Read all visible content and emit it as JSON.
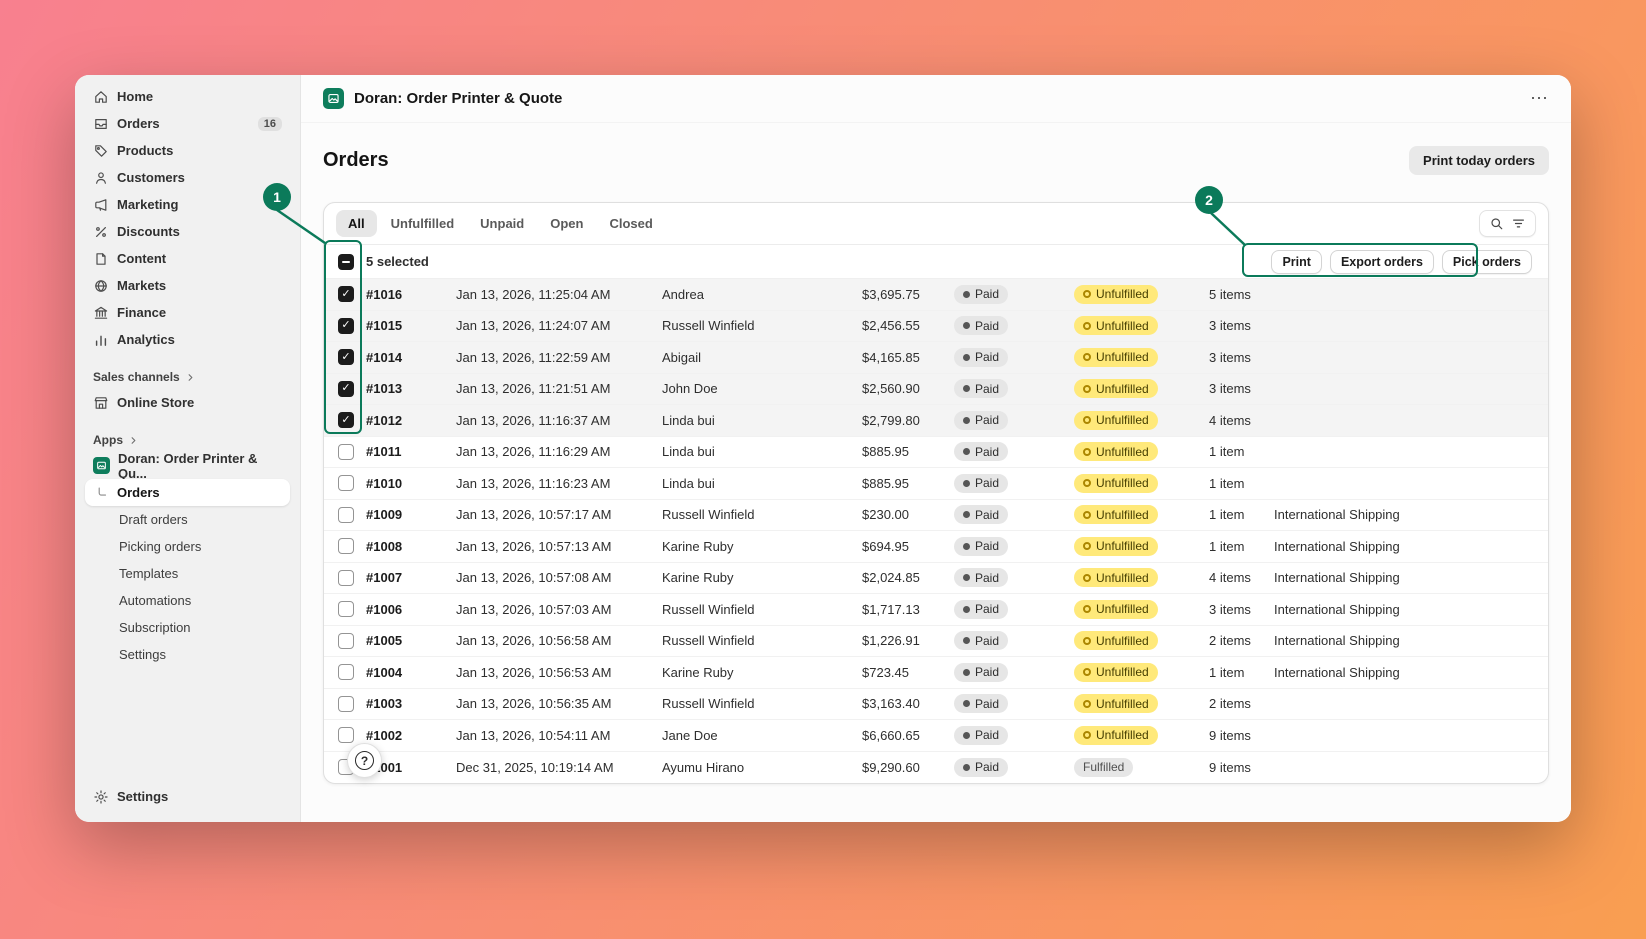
{
  "colors": {
    "annotation_green": "#0b7a5a",
    "badge_yellow": "#ffe97a",
    "badge_gray": "#e6e6e6",
    "gradient_start": "#f8808f",
    "gradient_end": "#f99e51"
  },
  "sidebar": {
    "items": [
      {
        "label": "Home",
        "icon": "home"
      },
      {
        "label": "Orders",
        "icon": "orders",
        "badge": "16"
      },
      {
        "label": "Products",
        "icon": "products"
      },
      {
        "label": "Customers",
        "icon": "customers"
      },
      {
        "label": "Marketing",
        "icon": "marketing"
      },
      {
        "label": "Discounts",
        "icon": "discounts"
      },
      {
        "label": "Content",
        "icon": "content"
      },
      {
        "label": "Markets",
        "icon": "markets"
      },
      {
        "label": "Finance",
        "icon": "finance"
      },
      {
        "label": "Analytics",
        "icon": "analytics"
      }
    ],
    "sales_channels_label": "Sales channels",
    "online_store_label": "Online Store",
    "apps_label": "Apps",
    "app_name": "Doran: Order Printer & Qu...",
    "app_sub_items": [
      "Orders",
      "Draft orders",
      "Picking orders",
      "Templates",
      "Automations",
      "Subscription",
      "Settings"
    ],
    "footer_settings_label": "Settings"
  },
  "header": {
    "app_title": "Doran: Order Printer & Quote",
    "overflow_menu": "⋯"
  },
  "page": {
    "title": "Orders",
    "primary_action": "Print today orders"
  },
  "tabs": {
    "items": [
      "All",
      "Unfulfilled",
      "Unpaid",
      "Open",
      "Closed"
    ],
    "active": "All"
  },
  "selection": {
    "label": "5 selected",
    "actions": [
      "Print",
      "Export orders",
      "Pick orders"
    ]
  },
  "orders": [
    {
      "id": "#1016",
      "date": "Jan 13, 2026, 11:25:04 AM",
      "customer": "Andrea",
      "total": "$3,695.75",
      "payment": "Paid",
      "fulfillment": "Unfulfilled",
      "items": "5 items",
      "delivery": "",
      "checked": true
    },
    {
      "id": "#1015",
      "date": "Jan 13, 2026, 11:24:07 AM",
      "customer": "Russell Winfield",
      "total": "$2,456.55",
      "payment": "Paid",
      "fulfillment": "Unfulfilled",
      "items": "3 items",
      "delivery": "",
      "checked": true
    },
    {
      "id": "#1014",
      "date": "Jan 13, 2026, 11:22:59 AM",
      "customer": "Abigail",
      "total": "$4,165.85",
      "payment": "Paid",
      "fulfillment": "Unfulfilled",
      "items": "3 items",
      "delivery": "",
      "checked": true
    },
    {
      "id": "#1013",
      "date": "Jan 13, 2026, 11:21:51 AM",
      "customer": "John Doe",
      "total": "$2,560.90",
      "payment": "Paid",
      "fulfillment": "Unfulfilled",
      "items": "3 items",
      "delivery": "",
      "checked": true
    },
    {
      "id": "#1012",
      "date": "Jan 13, 2026, 11:16:37 AM",
      "customer": "Linda bui",
      "total": "$2,799.80",
      "payment": "Paid",
      "fulfillment": "Unfulfilled",
      "items": "4 items",
      "delivery": "",
      "checked": true
    },
    {
      "id": "#1011",
      "date": "Jan 13, 2026, 11:16:29 AM",
      "customer": "Linda bui",
      "total": "$885.95",
      "payment": "Paid",
      "fulfillment": "Unfulfilled",
      "items": "1 item",
      "delivery": "",
      "checked": false
    },
    {
      "id": "#1010",
      "date": "Jan 13, 2026, 11:16:23 AM",
      "customer": "Linda bui",
      "total": "$885.95",
      "payment": "Paid",
      "fulfillment": "Unfulfilled",
      "items": "1 item",
      "delivery": "",
      "checked": false
    },
    {
      "id": "#1009",
      "date": "Jan 13, 2026, 10:57:17 AM",
      "customer": "Russell Winfield",
      "total": "$230.00",
      "payment": "Paid",
      "fulfillment": "Unfulfilled",
      "items": "1 item",
      "delivery": "International Shipping",
      "checked": false
    },
    {
      "id": "#1008",
      "date": "Jan 13, 2026, 10:57:13 AM",
      "customer": "Karine Ruby",
      "total": "$694.95",
      "payment": "Paid",
      "fulfillment": "Unfulfilled",
      "items": "1 item",
      "delivery": "International Shipping",
      "checked": false
    },
    {
      "id": "#1007",
      "date": "Jan 13, 2026, 10:57:08 AM",
      "customer": "Karine Ruby",
      "total": "$2,024.85",
      "payment": "Paid",
      "fulfillment": "Unfulfilled",
      "items": "4 items",
      "delivery": "International Shipping",
      "checked": false
    },
    {
      "id": "#1006",
      "date": "Jan 13, 2026, 10:57:03 AM",
      "customer": "Russell Winfield",
      "total": "$1,717.13",
      "payment": "Paid",
      "fulfillment": "Unfulfilled",
      "items": "3 items",
      "delivery": "International Shipping",
      "checked": false
    },
    {
      "id": "#1005",
      "date": "Jan 13, 2026, 10:56:58 AM",
      "customer": "Russell Winfield",
      "total": "$1,226.91",
      "payment": "Paid",
      "fulfillment": "Unfulfilled",
      "items": "2 items",
      "delivery": "International Shipping",
      "checked": false
    },
    {
      "id": "#1004",
      "date": "Jan 13, 2026, 10:56:53 AM",
      "customer": "Karine Ruby",
      "total": "$723.45",
      "payment": "Paid",
      "fulfillment": "Unfulfilled",
      "items": "1 item",
      "delivery": "International Shipping",
      "checked": false
    },
    {
      "id": "#1003",
      "date": "Jan 13, 2026, 10:56:35 AM",
      "customer": "Russell Winfield",
      "total": "$3,163.40",
      "payment": "Paid",
      "fulfillment": "Unfulfilled",
      "items": "2 items",
      "delivery": "",
      "checked": false
    },
    {
      "id": "#1002",
      "date": "Jan 13, 2026, 10:54:11 AM",
      "customer": "Jane Doe",
      "total": "$6,660.65",
      "payment": "Paid",
      "fulfillment": "Unfulfilled",
      "items": "9 items",
      "delivery": "",
      "checked": false
    },
    {
      "id": "#1001",
      "date": "Dec 31, 2025, 10:19:14 AM",
      "customer": "Ayumu Hirano",
      "total": "$9,290.60",
      "payment": "Paid",
      "fulfillment": "Fulfilled",
      "items": "9 items",
      "delivery": "",
      "checked": false
    }
  ],
  "help": {
    "label": "?"
  },
  "annotations": {
    "step1": "1",
    "step2": "2"
  }
}
